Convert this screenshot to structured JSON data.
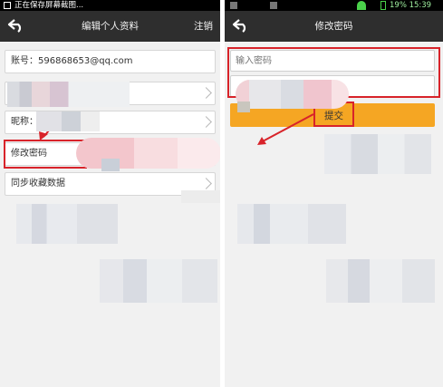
{
  "left": {
    "status_text": "正在保存屏幕截图...",
    "title": "编辑个人资料",
    "action_label": "注销",
    "account_row": "账号：596868653@qq.com",
    "nickname_row": "昵称：",
    "password_row": "修改密码",
    "sync_row": "同步收藏数据"
  },
  "right": {
    "status_right": "19%  15:39",
    "title": "修改密码",
    "password_placeholder": "输入密码",
    "submit_label": "提交"
  },
  "colors": {
    "highlight": "#d8232a",
    "submit_button": "#f5a623",
    "topbar": "#2e2e2e"
  }
}
